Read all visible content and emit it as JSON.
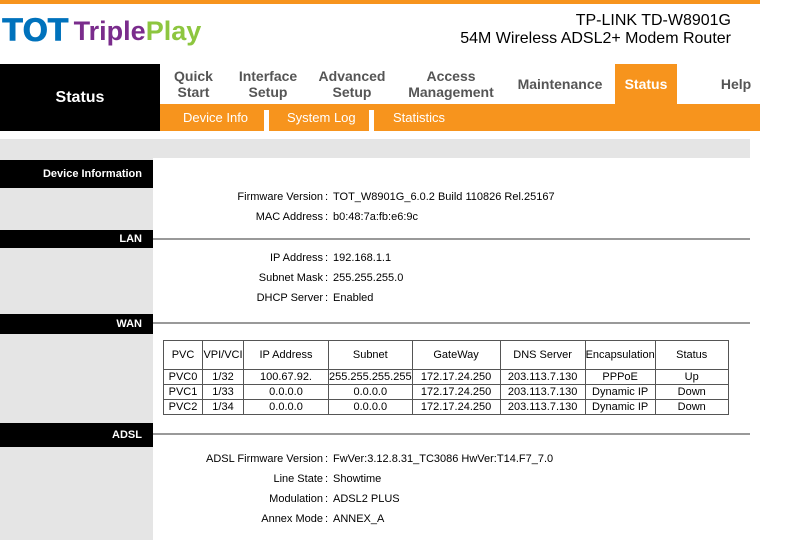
{
  "brand": {
    "tot": "TOT",
    "triple": "Triple",
    "play": "Play"
  },
  "product": {
    "name": "TP-LINK TD-W8901G",
    "desc": "54M Wireless ADSL2+ Modem Router"
  },
  "page_label": "Status",
  "nav": [
    {
      "line1": "Quick",
      "line2": "Start"
    },
    {
      "line1": "Interface",
      "line2": "Setup"
    },
    {
      "line1": "Advanced",
      "line2": "Setup"
    },
    {
      "line1": "Access",
      "line2": "Management"
    },
    {
      "line1": "Maintenance",
      "line2": ""
    },
    {
      "line1": "Status",
      "line2": ""
    },
    {
      "line1": "Help",
      "line2": ""
    }
  ],
  "subnav": [
    "Device Info",
    "System Log",
    "Statistics"
  ],
  "sections": {
    "device": "Device Information",
    "lan": "LAN",
    "wan": "WAN",
    "adsl": "ADSL"
  },
  "device": {
    "fw_label": "Firmware Version",
    "fw": "TOT_W8901G_6.0.2 Build 110826 Rel.25167",
    "mac_label": "MAC Address",
    "mac": "b0:48:7a:fb:e6:9c"
  },
  "lan": {
    "ip_label": "IP Address",
    "ip": "192.168.1.1",
    "mask_label": "Subnet Mask",
    "mask": "255.255.255.0",
    "dhcp_label": "DHCP Server",
    "dhcp": "Enabled"
  },
  "wan": {
    "headers": [
      "PVC",
      "VPI/VCI",
      "IP Address",
      "Subnet",
      "GateWay",
      "DNS Server",
      "Encapsulation",
      "Status"
    ],
    "rows": [
      [
        "PVC0",
        "1/32",
        "100.67.92.",
        "255.255.255.255",
        "172.17.24.250",
        "203.113.7.130",
        "PPPoE",
        "Up"
      ],
      [
        "PVC1",
        "1/33",
        "0.0.0.0",
        "0.0.0.0",
        "172.17.24.250",
        "203.113.7.130",
        "Dynamic IP",
        "Down"
      ],
      [
        "PVC2",
        "1/34",
        "0.0.0.0",
        "0.0.0.0",
        "172.17.24.250",
        "203.113.7.130",
        "Dynamic IP",
        "Down"
      ]
    ]
  },
  "adsl": {
    "fw_label": "ADSL Firmware Version",
    "fw": "FwVer:3.12.8.31_TC3086 HwVer:T14.F7_7.0",
    "line_label": "Line State",
    "line": "Showtime",
    "mod_label": "Modulation",
    "mod": "ADSL2 PLUS",
    "annex_label": "Annex Mode",
    "annex": "ANNEX_A"
  },
  "colors": {
    "accent": "#f7941d",
    "tot_blue": "#0072bc",
    "triple_purple": "#7a2c8c",
    "play_green": "#8dc63f"
  }
}
